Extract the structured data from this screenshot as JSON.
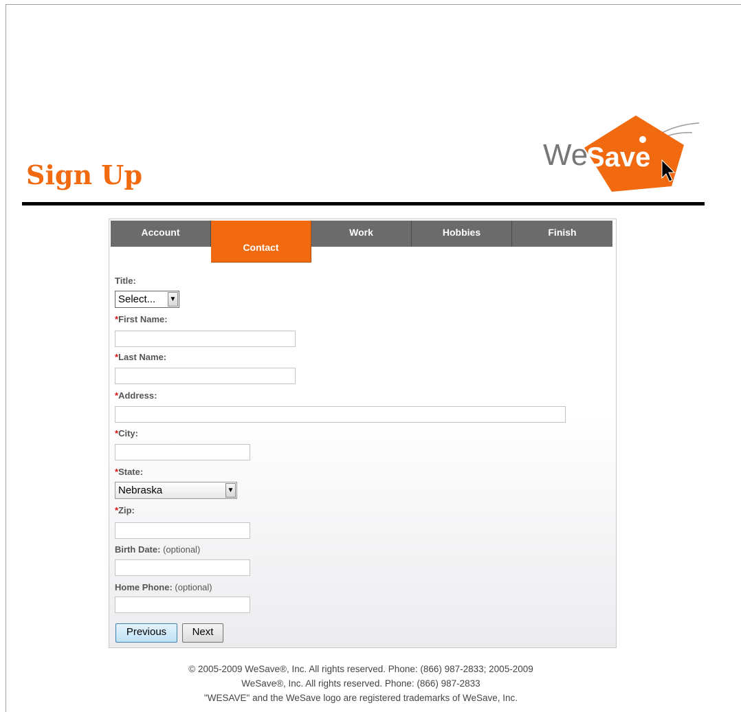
{
  "header": {
    "title": "Sign Up",
    "logo_text_we": "We",
    "logo_text_save": "Save",
    "brand_color": "#f26a10"
  },
  "tabs": [
    {
      "label": "Account",
      "active": false
    },
    {
      "label": "Contact",
      "active": true
    },
    {
      "label": "Work",
      "active": false
    },
    {
      "label": "Hobbies",
      "active": false
    },
    {
      "label": "Finish",
      "active": false
    }
  ],
  "form": {
    "title": {
      "label": "Title:",
      "value": "Select..."
    },
    "first_name": {
      "required_mark": "*",
      "label": "First Name:",
      "value": ""
    },
    "last_name": {
      "required_mark": "*",
      "label": "Last Name:",
      "value": ""
    },
    "address": {
      "required_mark": "*",
      "label": "Address:",
      "value": ""
    },
    "city": {
      "required_mark": "*",
      "label": "City:",
      "value": ""
    },
    "state": {
      "required_mark": "*",
      "label": "State:",
      "value": "Nebraska"
    },
    "zip": {
      "required_mark": "*",
      "label": "Zip:",
      "value": ""
    },
    "birth_date": {
      "label": "Birth Date:",
      "optional": "(optional)",
      "value": ""
    },
    "home_phone": {
      "label": "Home Phone:",
      "optional": "(optional)",
      "value": ""
    }
  },
  "buttons": {
    "previous": "Previous",
    "next": "Next"
  },
  "footer": {
    "line1": "© 2005-2009 WeSave®, Inc. All rights reserved. Phone: (866) 987-2833; 2005-2009",
    "line2": "WeSave®, Inc. All rights reserved. Phone: (866) 987-2833",
    "line3": "\"WESAVE\" and the WeSave logo are registered trademarks of WeSave, Inc."
  }
}
